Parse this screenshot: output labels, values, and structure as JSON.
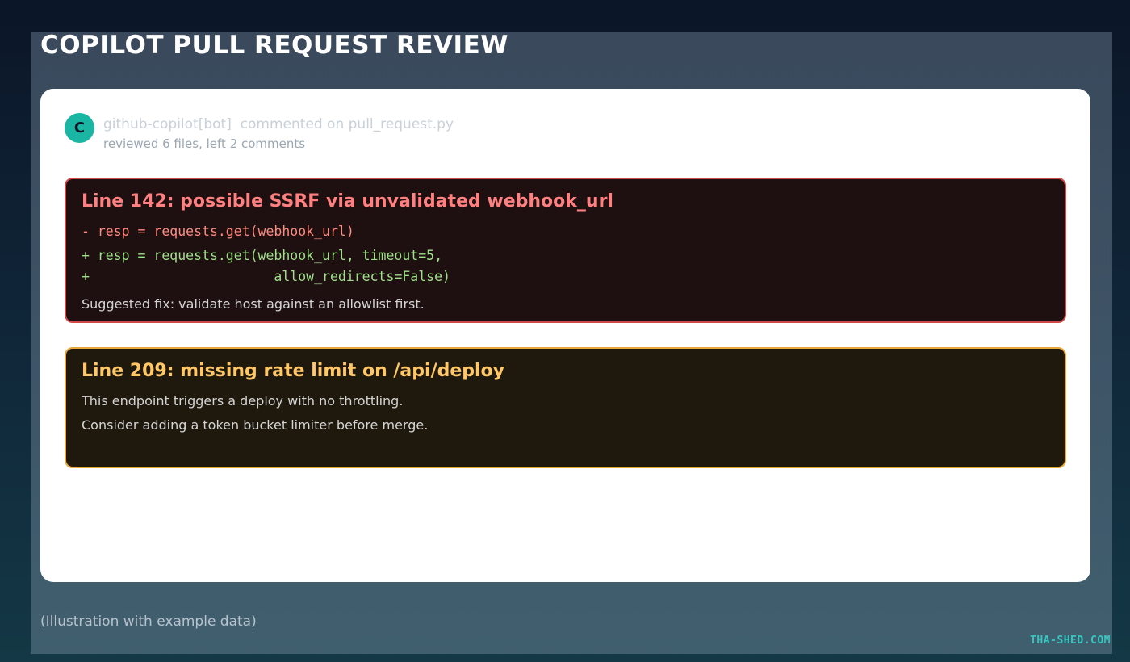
{
  "page": {
    "title": "COPILOT PULL REQUEST REVIEW",
    "caption": "(Illustration with example data)",
    "brand": "THA-SHED.COM"
  },
  "review": {
    "avatar_letter": "C",
    "author": "github-copilot[bot]",
    "action": "commented on pull_request.py",
    "summary": "reviewed 6 files, left 2 comments"
  },
  "comments": [
    {
      "severity": "danger",
      "title": "Line 142: possible SSRF via unvalidated webhook_url",
      "removed": "- resp = requests.get(webhook_url)",
      "added": [
        "+ resp = requests.get(webhook_url, timeout=5,",
        "+                       allow_redirects=False)"
      ],
      "note": "Suggested fix: validate host against an allowlist first."
    },
    {
      "severity": "warning",
      "title": "Line 209: missing rate limit on /api/deploy",
      "notes": [
        "This endpoint triggers a deploy with no throttling.",
        "Consider adding a token bucket limiter before merge."
      ]
    }
  ],
  "colors": {
    "danger_border": "#d24848",
    "warning_border": "#e8a93a",
    "avatar": "#1ab5a3",
    "brand": "#37c7c0"
  }
}
